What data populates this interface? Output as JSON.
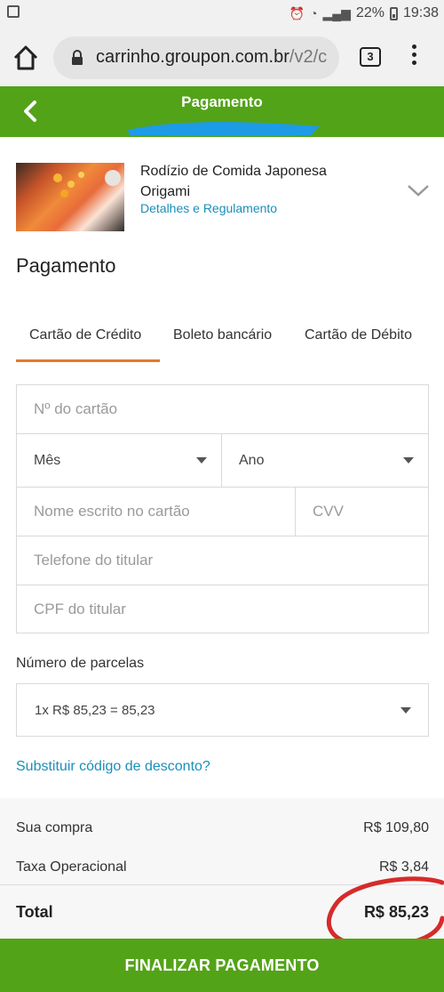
{
  "status_bar": {
    "battery": "22%",
    "time": "19:38"
  },
  "browser": {
    "url_host": "carrinho.groupon.com.br",
    "url_path": "/v2/c",
    "tab_count": "3"
  },
  "header": {
    "title": "Pagamento"
  },
  "product": {
    "title": "Rodízio de Comida Japonesa Origami",
    "details_link": "Detalhes e Regulamento"
  },
  "payment": {
    "section_title": "Pagamento",
    "tabs": [
      {
        "label": "Cartão de Crédito",
        "active": true
      },
      {
        "label": "Boleto bancário",
        "active": false
      },
      {
        "label": "Cartão de Débito",
        "active": false
      }
    ],
    "form": {
      "card_number_placeholder": "Nº do cartão",
      "month_label": "Mês",
      "year_label": "Ano",
      "name_placeholder": "Nome escrito no cartão",
      "cvv_placeholder": "CVV",
      "phone_placeholder": "Telefone do titular",
      "cpf_placeholder": "CPF do titular"
    },
    "installments_label": "Número de parcelas",
    "installments_value": "1x R$ 85,23 = 85,23",
    "discount_link": "Substituir código de desconto?"
  },
  "summary": {
    "purchase_label": "Sua compra",
    "purchase_value": "R$ 109,80",
    "fee_label": "Taxa Operacional",
    "fee_value": "R$ 3,84",
    "total_label": "Total",
    "total_value": "R$ 85,23"
  },
  "finish_button": "FINALIZAR PAGAMENTO",
  "colors": {
    "brand_green": "#53a318",
    "link_blue": "#1a8fb8",
    "tab_accent": "#e27a2e",
    "annotation_red": "#d62b2b",
    "annotation_blue": "#1e9be6"
  }
}
